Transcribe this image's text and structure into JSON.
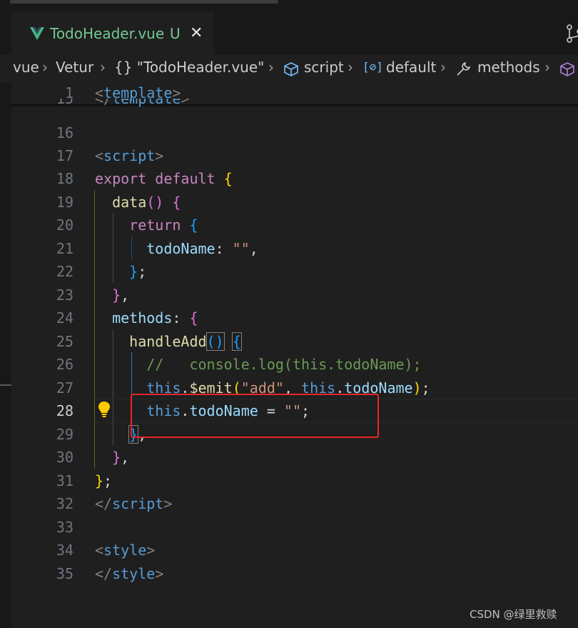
{
  "tab": {
    "title": "TodoHeader.vue",
    "status": "U",
    "close": "✕"
  },
  "breadcrumbs": [
    "vue",
    "Vetur",
    "{} \"TodoHeader.vue\"",
    "script",
    "default",
    "methods"
  ],
  "breadcrumb_sep": "›",
  "code": {
    "l1": {
      "num": "1"
    },
    "l15": {
      "num": "15"
    },
    "l16": {
      "num": "16"
    },
    "l17": {
      "num": "17"
    },
    "l18": {
      "num": "18",
      "kw1": "export",
      "kw2": "default"
    },
    "l19": {
      "num": "19",
      "fn": "data"
    },
    "l20": {
      "num": "20",
      "kw": "return"
    },
    "l21": {
      "num": "21",
      "prop": "todoName",
      "str": "\"\""
    },
    "l22": {
      "num": "22"
    },
    "l23": {
      "num": "23"
    },
    "l24": {
      "num": "24",
      "prop": "methods"
    },
    "l25": {
      "num": "25",
      "fn": "handleAdd"
    },
    "l26": {
      "num": "26",
      "comment": "//   console.log(this.todoName);"
    },
    "l27": {
      "num": "27",
      "this1": "this",
      "fn": "$emit",
      "str": "\"add\"",
      "this2": "this",
      "prop": "todoName"
    },
    "l28": {
      "num": "28",
      "this": "this",
      "prop": "todoName",
      "str": "\"\""
    },
    "l29": {
      "num": "29"
    },
    "l30": {
      "num": "30"
    },
    "l31": {
      "num": "31"
    },
    "l32": {
      "num": "32"
    },
    "l33": {
      "num": "33"
    },
    "l34": {
      "num": "34"
    },
    "l35": {
      "num": "35"
    },
    "tags": {
      "template": "template",
      "script": "script",
      "style": "style"
    }
  },
  "watermark": "CSDN @绿里救赎",
  "colors": {
    "accent_modified": "#73c991",
    "highlight_box": "#e8252a"
  }
}
